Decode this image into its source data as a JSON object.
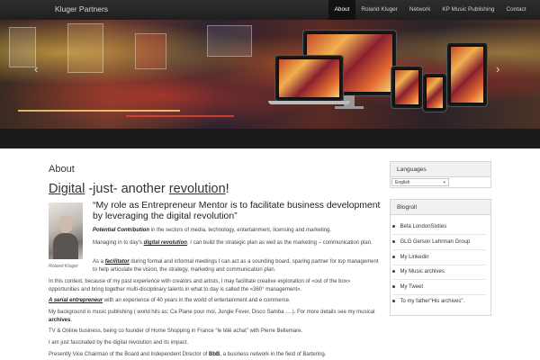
{
  "site": {
    "brand": "Kluger Partners"
  },
  "nav": [
    "About",
    "Roland Kluger",
    "Network",
    "KP Music Publishing",
    "Contact"
  ],
  "hero": {
    "prev_icon": "‹",
    "next_icon": "›"
  },
  "page": {
    "title": "About",
    "headline": {
      "w1": "Digital",
      "w2": " -just- another ",
      "w3": "revolution",
      "w4": "!"
    },
    "photo_caption": "Roland Kluger",
    "quote": "“My role as Entrepreneur Mentor is to facilitate business development  by leveraging the digital revolution”",
    "p1": {
      "bold": "Potential Contribution",
      "rest": " in the sectors of media, technology, entertainment, licensing and marketing."
    },
    "p2": {
      "a": "Managing in to day’s ",
      "b": "digital revolution",
      "c": ", I can build the strategic plan as well as the marketing – communication plan."
    },
    "p3": {
      "a": "As a ",
      "b": "facilitator",
      "c": " during formal and informal meetings I can act as a sounding board, sparing partner for top management to help articulate the vision, the strategy, marketing and communication plan."
    },
    "p4": "In this context, because of my past experience with creators and artists, I may facilitate creative exploration of «out of the box» opportunities and bring together multi-disciplinary talents in what to day is called the «360° management».",
    "p5": {
      "a": "A serial ",
      "b": "entrepreneur",
      "c": " with an experience of 40 years in the world of entertainment and e commerce."
    },
    "p6": {
      "a": "My background is music publishing ( world hits as: Ca Plane pour moi, Jungle Fever, Disco Samba ….). For more details see my musical ",
      "b": "archives",
      "c": "."
    },
    "p7": "TV & Online business, being  co founder of Home Shopping in France “le télé achat” with Pierre Bellemare.",
    "p8": "I am just fascinated by the digital revolution and its impact.",
    "p9": {
      "a": "Presently Vice Chairman of the Board and Independent Director of ",
      "b": "BbB",
      "c": ", a business network in the field of Bartering."
    }
  },
  "sidebar": {
    "languages": {
      "title": "Languages",
      "selected": "English"
    },
    "blogroll": {
      "title": "Blogroll",
      "items": [
        "Beta LondonSixties",
        "GLG Gerson Lehrman Group",
        "My Linkedin",
        "My Music archives",
        "My Tweet",
        "To my father\"His archives\"."
      ]
    }
  }
}
